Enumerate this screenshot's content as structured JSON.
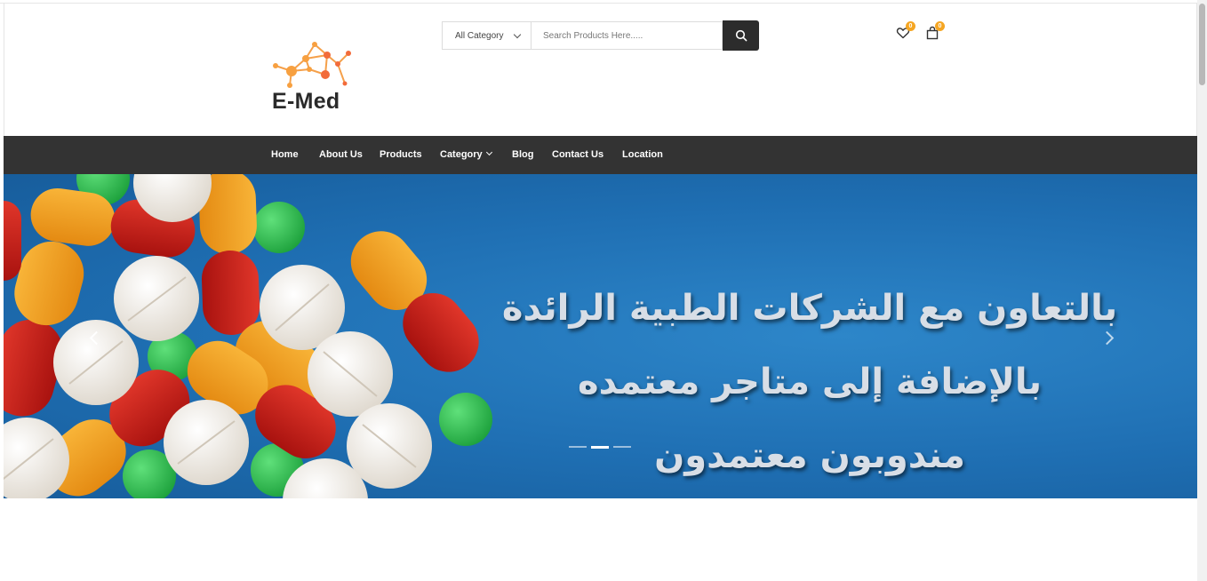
{
  "brand": {
    "name": "E-Med",
    "accent": "#f5a623",
    "logo_colors": [
      "#f7a040",
      "#f26b3a"
    ]
  },
  "search": {
    "category_selected": "All Category",
    "placeholder": "Search Products Here.....",
    "button_icon": "search-icon"
  },
  "header_icons": {
    "wishlist": {
      "icon": "heart-icon",
      "count": "0"
    },
    "cart": {
      "icon": "shopping-bag-icon",
      "count": "0"
    }
  },
  "nav": {
    "items": [
      {
        "label": "Home"
      },
      {
        "label": "About Us"
      },
      {
        "label": "Products"
      },
      {
        "label": "Category"
      },
      {
        "label": "Blog"
      },
      {
        "label": "Contact Us"
      },
      {
        "label": "Location"
      }
    ]
  },
  "hero": {
    "lines": [
      "بالتعاون  مع الشركات الطبية الرائدة",
      "بالإضافة إلى متاجر معتمده",
      "مندوبون معتمدون"
    ],
    "slide_count": 3,
    "active_slide": 2,
    "prev_icon": "chevron-left-icon",
    "next_icon": "chevron-right-icon"
  }
}
